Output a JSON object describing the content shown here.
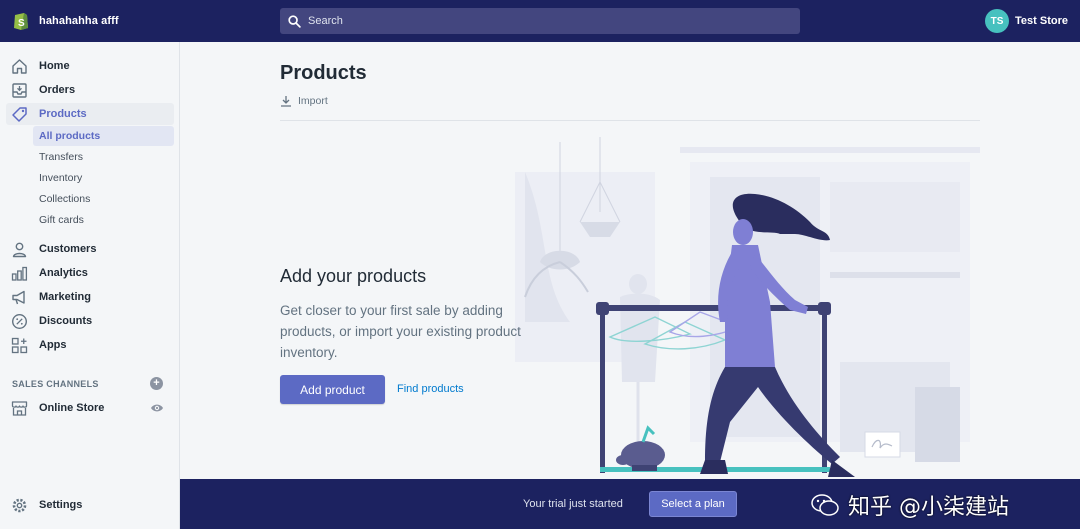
{
  "topbar": {
    "store_title": "hahahahha afff",
    "search_placeholder": "Search",
    "avatar_initials": "TS",
    "account_name": "Test Store"
  },
  "sidebar": {
    "items": [
      {
        "label": "Home",
        "icon": "home-icon"
      },
      {
        "label": "Orders",
        "icon": "orders-icon"
      },
      {
        "label": "Products",
        "icon": "tag-icon"
      },
      {
        "label": "Customers",
        "icon": "person-icon"
      },
      {
        "label": "Analytics",
        "icon": "bar-chart-icon"
      },
      {
        "label": "Marketing",
        "icon": "megaphone-icon"
      },
      {
        "label": "Discounts",
        "icon": "discount-icon"
      },
      {
        "label": "Apps",
        "icon": "apps-icon"
      }
    ],
    "product_subitems": [
      "All products",
      "Transfers",
      "Inventory",
      "Collections",
      "Gift cards"
    ],
    "sales_channels_title": "SALES CHANNELS",
    "online_store": "Online Store",
    "settings": "Settings"
  },
  "main": {
    "page_title": "Products",
    "import_label": "Import",
    "empty_title": "Add your products",
    "empty_text": "Get closer to your first sale by adding products, or import your existing product inventory.",
    "primary_button": "Add product",
    "secondary_link": "Find products"
  },
  "footer": {
    "trial_text": "Your trial just started",
    "plan_button": "Select a plan",
    "watermark_text": "知乎 @小柒建站"
  },
  "colors": {
    "topbar": "#1c2260",
    "accent": "#5c6ac4",
    "avatar": "#47c1bf",
    "link": "#007ace"
  }
}
